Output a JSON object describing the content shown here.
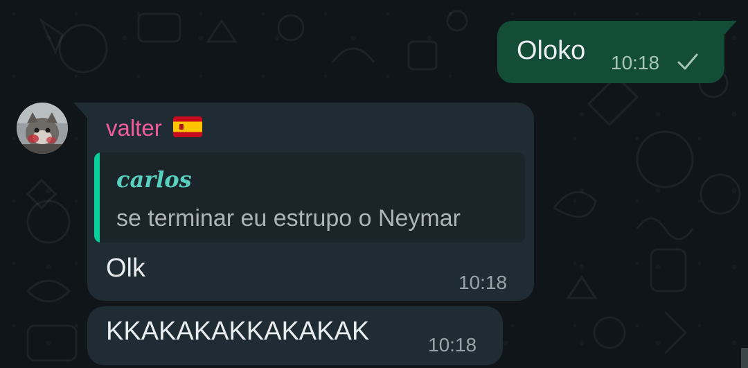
{
  "outgoing": {
    "text": "Oloko",
    "time": "10:18",
    "status_icon": "check-icon"
  },
  "incoming": {
    "sender": "valter",
    "sender_flag": "spain-flag-icon",
    "reply": {
      "author": "carlos",
      "text": "se terminar eu estrupo o Neymar"
    },
    "messages": [
      {
        "text": "Olk",
        "time": "10:18"
      },
      {
        "text": "KKAKAKAKKAKAKAK",
        "time": "10:18"
      }
    ]
  },
  "colors": {
    "background": "#0f1519",
    "outgoing_bubble": "#144d37",
    "incoming_bubble": "#1f2c33",
    "sender_name": "#f15c99",
    "quote_bar": "#06cf9c",
    "quote_author": "#58d0bd"
  }
}
